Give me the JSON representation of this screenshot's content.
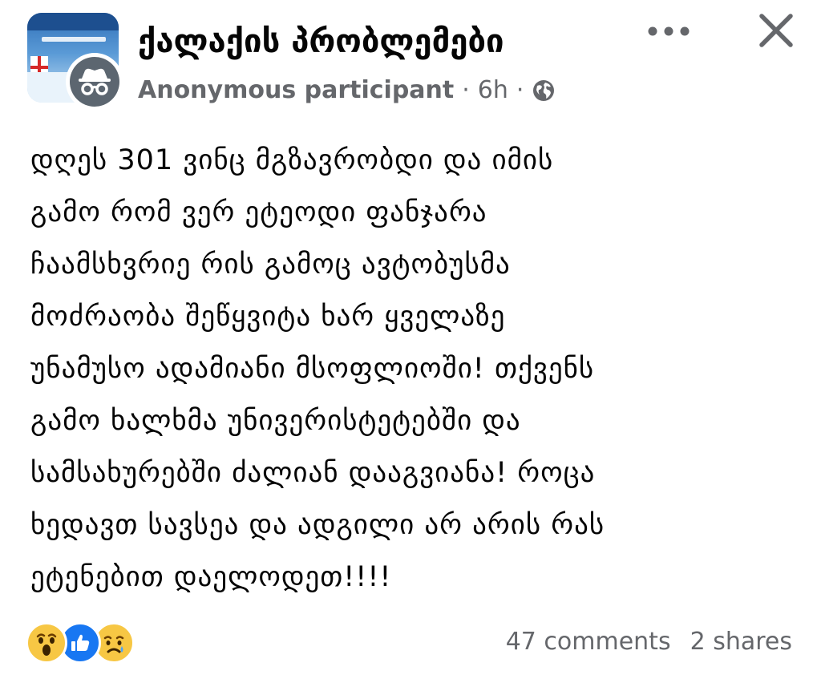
{
  "header": {
    "group_name": "ქალაქის პრობლემები",
    "author": "Anonymous participant",
    "separator": "·",
    "time": "6h",
    "privacy_icon": "globe-icon",
    "more_icon": "more-options-icon",
    "close_icon": "close-icon",
    "avatar_icon": "incognito-icon"
  },
  "post": {
    "lines": [
      "დღეს 301 ვინც მგზავრობდი და იმის",
      "გამო რომ ვერ ეტეოდი ფანჯარა",
      "ჩაამსხვრიე რის გამოც ავტობუსმა",
      "მოძრაობა შეწყვიტა ხარ ყველაზე",
      "უნამუსო ადამიანი მსოფლიოში! თქვენს",
      "გამო ხალხმა უნივერისტეტებში და",
      "სამსახურებში ძალიან დააგვიანა! როცა",
      "ხედავთ სავსეა და ადგილი არ არის რას",
      "ეტენებით დაელოდეთ!!!!"
    ]
  },
  "footer": {
    "reactions": [
      "wow-reaction-icon",
      "like-reaction-icon",
      "sad-reaction-icon"
    ],
    "comments": "47 comments",
    "shares": "2 shares"
  },
  "colors": {
    "text": "#050505",
    "secondary": "#65676b",
    "like_blue": "#1877f2",
    "emoji_yellow": "#f7c744"
  }
}
